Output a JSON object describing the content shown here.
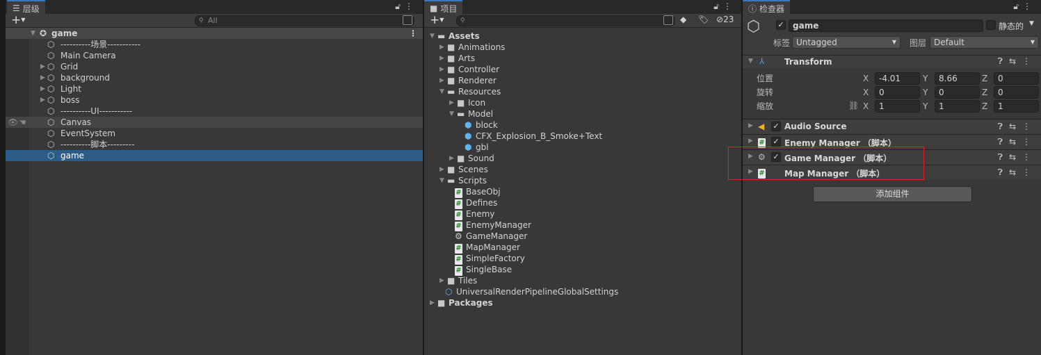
{
  "hierarchy": {
    "tab_label": "层级",
    "search_placeholder": "All",
    "scene_name": "game",
    "items": [
      {
        "label": "----------场景-----------",
        "expandable": false
      },
      {
        "label": "Main Camera",
        "expandable": false
      },
      {
        "label": "Grid",
        "expandable": true
      },
      {
        "label": "background",
        "expandable": true
      },
      {
        "label": "Light",
        "expandable": true
      },
      {
        "label": "boss",
        "expandable": true
      },
      {
        "label": "----------UI-----------",
        "expandable": false
      },
      {
        "label": "Canvas",
        "expandable": false,
        "hovered": true
      },
      {
        "label": "EventSystem",
        "expandable": false
      },
      {
        "label": "----------脚本---------",
        "expandable": false
      },
      {
        "label": "game",
        "expandable": false,
        "selected": true
      }
    ]
  },
  "project": {
    "tab_label": "项目",
    "hidden_count": "23",
    "tree": [
      {
        "label": "Assets",
        "depth": 0,
        "type": "folder-open",
        "arrow": "open",
        "bold": true
      },
      {
        "label": "Animations",
        "depth": 1,
        "type": "folder",
        "arrow": "closed"
      },
      {
        "label": "Arts",
        "depth": 1,
        "type": "folder",
        "arrow": "closed"
      },
      {
        "label": "Controller",
        "depth": 1,
        "type": "folder",
        "arrow": "closed"
      },
      {
        "label": "Renderer",
        "depth": 1,
        "type": "folder",
        "arrow": "closed"
      },
      {
        "label": "Resources",
        "depth": 1,
        "type": "folder-open",
        "arrow": "open"
      },
      {
        "label": "Icon",
        "depth": 2,
        "type": "folder",
        "arrow": "closed"
      },
      {
        "label": "Model",
        "depth": 2,
        "type": "folder-open",
        "arrow": "open"
      },
      {
        "label": "block",
        "depth": 3,
        "type": "prefab"
      },
      {
        "label": "CFX_Explosion_B_Smoke+Text",
        "depth": 3,
        "type": "prefab"
      },
      {
        "label": "gbl",
        "depth": 3,
        "type": "prefab"
      },
      {
        "label": "Sound",
        "depth": 2,
        "type": "folder",
        "arrow": "closed"
      },
      {
        "label": "Scenes",
        "depth": 1,
        "type": "folder",
        "arrow": "closed"
      },
      {
        "label": "Scripts",
        "depth": 1,
        "type": "folder-open",
        "arrow": "open"
      },
      {
        "label": "BaseObj",
        "depth": 2,
        "type": "script"
      },
      {
        "label": "Defines",
        "depth": 2,
        "type": "script"
      },
      {
        "label": "Enemy",
        "depth": 2,
        "type": "script"
      },
      {
        "label": "EnemyManager",
        "depth": 2,
        "type": "script"
      },
      {
        "label": "GameManager",
        "depth": 2,
        "type": "gear"
      },
      {
        "label": "MapManager",
        "depth": 2,
        "type": "script"
      },
      {
        "label": "SimpleFactory",
        "depth": 2,
        "type": "script"
      },
      {
        "label": "SingleBase",
        "depth": 2,
        "type": "script"
      },
      {
        "label": "Tiles",
        "depth": 1,
        "type": "folder",
        "arrow": "closed"
      },
      {
        "label": "UniversalRenderPipelineGlobalSettings",
        "depth": 1,
        "type": "settings"
      },
      {
        "label": "Packages",
        "depth": 0,
        "type": "folder",
        "arrow": "closed",
        "bold": true
      }
    ]
  },
  "inspector": {
    "tab_label": "检查器",
    "object_name": "game",
    "active": true,
    "static_label": "静态的",
    "tag_label": "标签",
    "tag_value": "Untagged",
    "layer_label": "图层",
    "layer_value": "Default",
    "transform": {
      "title": "Transform",
      "rows": [
        {
          "label": "位置",
          "x": "-4.01",
          "y": "8.66",
          "z": "0"
        },
        {
          "label": "旋转",
          "x": "0",
          "y": "0",
          "z": "0"
        },
        {
          "label": "缩放",
          "x": "1",
          "y": "1",
          "z": "1"
        }
      ],
      "axis": {
        "x": "X",
        "y": "Y",
        "z": "Z"
      }
    },
    "components": [
      {
        "title": "Audio Source",
        "icon": "audio-icon",
        "checkbox": true
      },
      {
        "title": "Enemy Manager （脚本）",
        "icon": "script-icon",
        "checkbox": true
      },
      {
        "title": "Game Manager （脚本）",
        "icon": "gear-icon",
        "checkbox": true
      },
      {
        "title": "Map Manager （脚本）",
        "icon": "script-icon",
        "checkbox": false
      }
    ],
    "add_component_label": "添加组件"
  },
  "colors": {
    "selection": "#2c5d87",
    "highlight_box": "#e02020",
    "tab_accent": "#3a79bb"
  }
}
